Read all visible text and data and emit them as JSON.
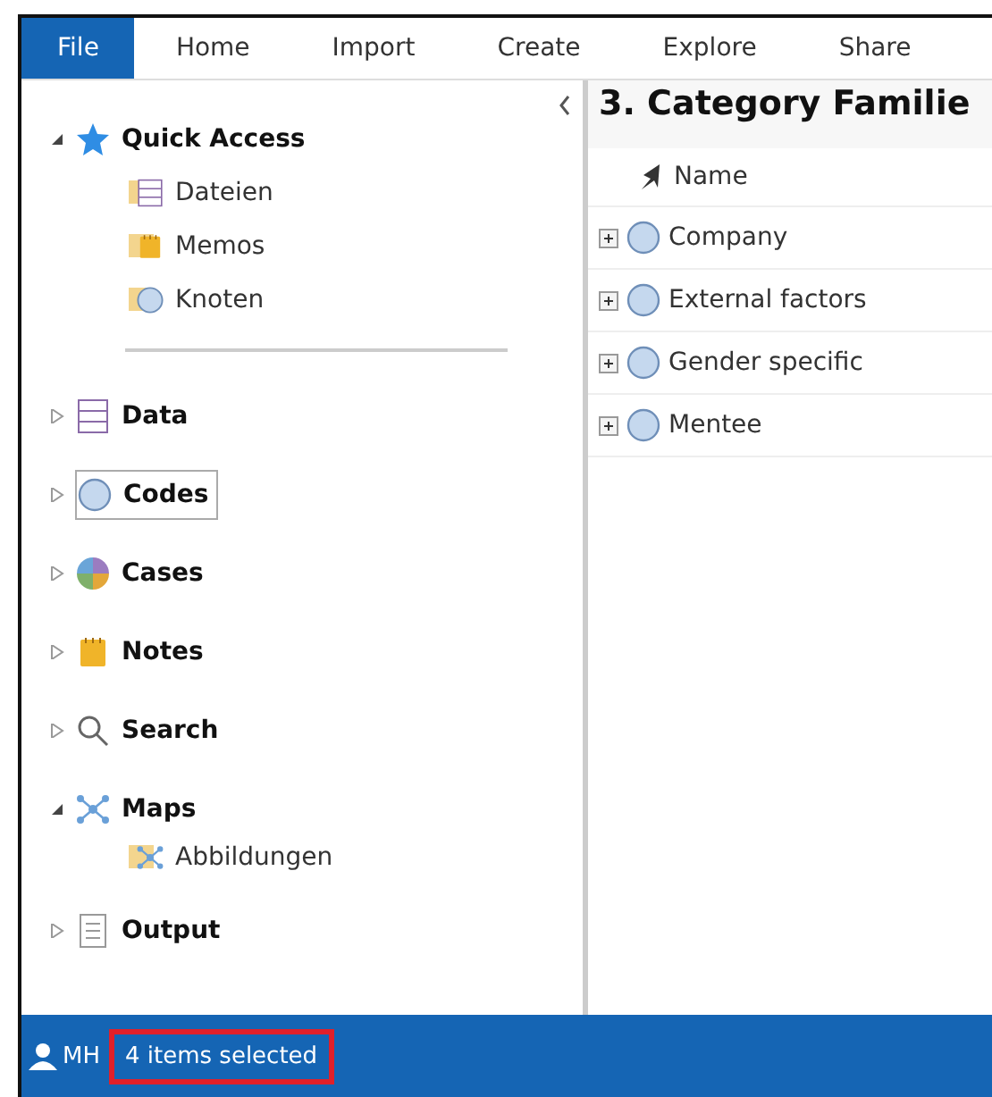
{
  "menu": [
    {
      "label": "File",
      "selected": true
    },
    {
      "label": "Home",
      "selected": false
    },
    {
      "label": "Import",
      "selected": false
    },
    {
      "label": "Create",
      "selected": false
    },
    {
      "label": "Explore",
      "selected": false
    },
    {
      "label": "Share",
      "selected": false
    }
  ],
  "quick_access": {
    "label": "Quick Access",
    "expanded": true,
    "children": [
      {
        "label": "Dateien",
        "kind": "data"
      },
      {
        "label": "Memos",
        "kind": "notes"
      },
      {
        "label": "Knoten",
        "kind": "codes"
      }
    ]
  },
  "sections": [
    {
      "label": "Data",
      "kind": "data",
      "expanded": false,
      "selected": false
    },
    {
      "label": "Codes",
      "kind": "codes",
      "expanded": false,
      "selected": true
    },
    {
      "label": "Cases",
      "kind": "cases",
      "expanded": false,
      "selected": false
    },
    {
      "label": "Notes",
      "kind": "notes",
      "expanded": false,
      "selected": false
    },
    {
      "label": "Search",
      "kind": "search",
      "expanded": false,
      "selected": false
    },
    {
      "label": "Maps",
      "kind": "maps",
      "expanded": true,
      "selected": false,
      "children": [
        {
          "label": "Abbildungen",
          "kind": "maps"
        }
      ]
    },
    {
      "label": "Output",
      "kind": "output",
      "expanded": false,
      "selected": false
    }
  ],
  "content": {
    "title": "3. Category Familie",
    "columns": [
      "Name"
    ],
    "rows": [
      {
        "name": "Company"
      },
      {
        "name": "External factors"
      },
      {
        "name": "Gender specific"
      },
      {
        "name": "Mentee"
      }
    ]
  },
  "status_bar": {
    "user": "MH",
    "message": "4 items selected",
    "highlighted": true
  }
}
